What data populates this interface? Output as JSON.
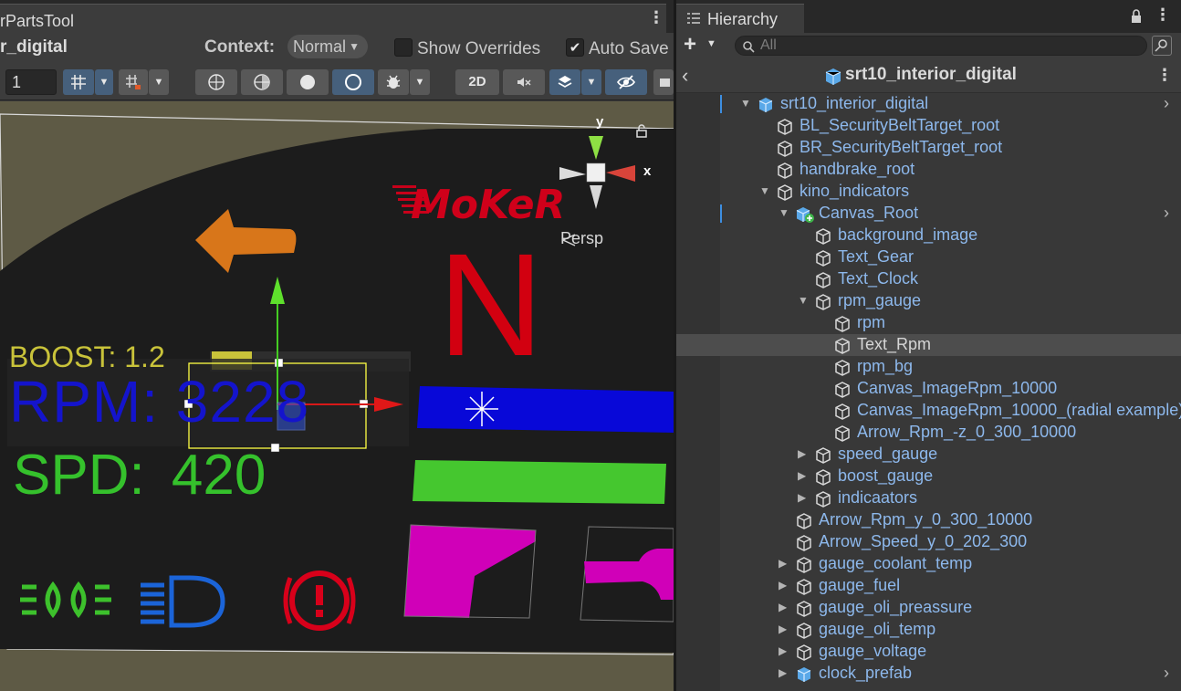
{
  "scene_panel": {
    "tab_title": "rPartsTool",
    "scene_name": "r_digital",
    "context_label": "Context:",
    "context_value": "Normal",
    "show_overrides_label": "Show Overrides",
    "show_overrides_checked": false,
    "auto_save_label": "Auto Save",
    "auto_save_checked": true,
    "grid_size_value": "1",
    "mode_2d_label": "2D",
    "viewport": {
      "boost_text": "BOOST: 1.2",
      "rpm_text": "RPM: 3228",
      "speed_text": "SPD:  420",
      "gear_text": "N",
      "logo_text": "MoKeR",
      "persp_label": "Persp",
      "axis_y_label": "y",
      "axis_x_label": "x"
    }
  },
  "hierarchy": {
    "tab_title": "Hierarchy",
    "search_placeholder": "All",
    "header_title": "srt10_interior_digital",
    "rows": [
      {
        "label": "srt10_interior_digital"
      },
      {
        "label": "BL_SecurityBeltTarget_root"
      },
      {
        "label": "BR_SecurityBeltTarget_root"
      },
      {
        "label": "handbrake_root"
      },
      {
        "label": "kino_indicators"
      },
      {
        "label": "Canvas_Root"
      },
      {
        "label": "background_image"
      },
      {
        "label": "Text_Gear"
      },
      {
        "label": "Text_Clock"
      },
      {
        "label": "rpm_gauge"
      },
      {
        "label": "rpm"
      },
      {
        "label": "Text_Rpm"
      },
      {
        "label": "rpm_bg"
      },
      {
        "label": "Canvas_ImageRpm_10000"
      },
      {
        "label": "Canvas_ImageRpm_10000_(radial example)"
      },
      {
        "label": "Arrow_Rpm_-z_0_300_10000"
      },
      {
        "label": "speed_gauge"
      },
      {
        "label": "boost_gauge"
      },
      {
        "label": "indicaators"
      },
      {
        "label": "Arrow_Rpm_y_0_300_10000"
      },
      {
        "label": "Arrow_Speed_y_0_202_300"
      },
      {
        "label": "gauge_coolant_temp"
      },
      {
        "label": "gauge_fuel"
      },
      {
        "label": "gauge_oli_preassure"
      },
      {
        "label": "gauge_oli_temp"
      },
      {
        "label": "gauge_voltage"
      },
      {
        "label": "clock_prefab"
      }
    ]
  },
  "colors": {
    "accent_blue": "#3d8ee0",
    "tree_text": "#8db8ec",
    "rpm_blue": "#1414cc",
    "speed_green": "#35c12c",
    "boost_yellow": "#c9c33a",
    "gear_red": "#d20010"
  }
}
